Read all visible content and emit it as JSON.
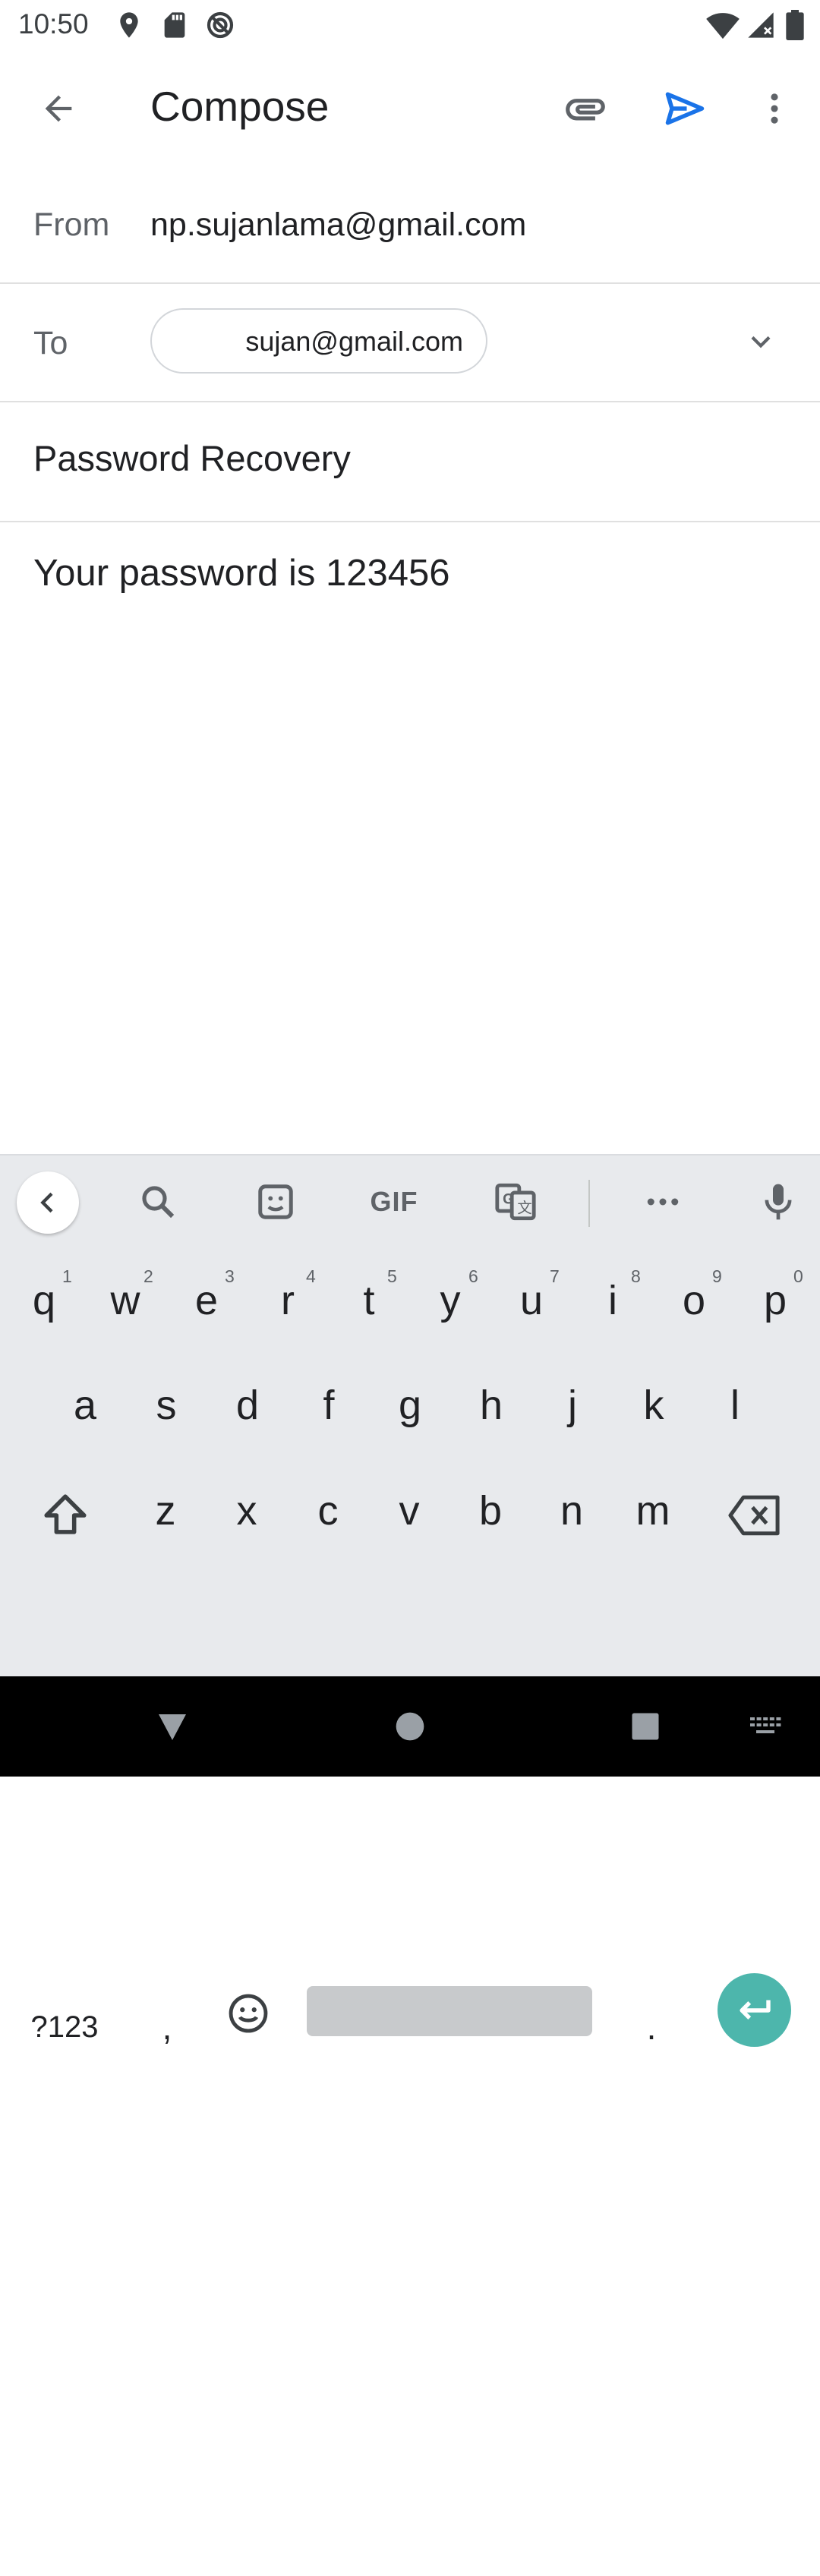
{
  "status_bar": {
    "time": "10:50",
    "icons_left": [
      "location-icon",
      "sd-card-icon",
      "do-not-disturb-icon"
    ],
    "icons_right": [
      "wifi-icon",
      "signal-icon",
      "battery-icon"
    ]
  },
  "app_bar": {
    "title": "Compose",
    "icons": [
      "back-arrow-icon",
      "attach-icon",
      "send-icon",
      "more-vert-icon"
    ],
    "accent_color": "#1a73e8"
  },
  "from": {
    "label": "From",
    "value": "np.sujanlama@gmail.com"
  },
  "to": {
    "label": "To",
    "chip": "sujan@gmail.com"
  },
  "subject": "Password Recovery",
  "body": "Your password is 123456",
  "keyboard": {
    "toolbar_icons": [
      "collapse-icon",
      "search-icon",
      "sticker-icon",
      "gif-icon",
      "translate-icon",
      "more-icon",
      "mic-icon"
    ],
    "gif_label": "GIF",
    "row1": [
      {
        "k": "q",
        "h": "1"
      },
      {
        "k": "w",
        "h": "2"
      },
      {
        "k": "e",
        "h": "3"
      },
      {
        "k": "r",
        "h": "4"
      },
      {
        "k": "t",
        "h": "5"
      },
      {
        "k": "y",
        "h": "6"
      },
      {
        "k": "u",
        "h": "7"
      },
      {
        "k": "i",
        "h": "8"
      },
      {
        "k": "o",
        "h": "9"
      },
      {
        "k": "p",
        "h": "0"
      }
    ],
    "row2": [
      "a",
      "s",
      "d",
      "f",
      "g",
      "h",
      "j",
      "k",
      "l"
    ],
    "row3": [
      "z",
      "x",
      "c",
      "v",
      "b",
      "n",
      "m"
    ],
    "symbols_label": "?123",
    "comma": ",",
    "period": ".",
    "enter_color": "#4db6ac"
  },
  "nav_bar": {
    "icons": [
      "back-icon",
      "home-icon",
      "recents-icon",
      "keyboard-switch-icon"
    ]
  }
}
